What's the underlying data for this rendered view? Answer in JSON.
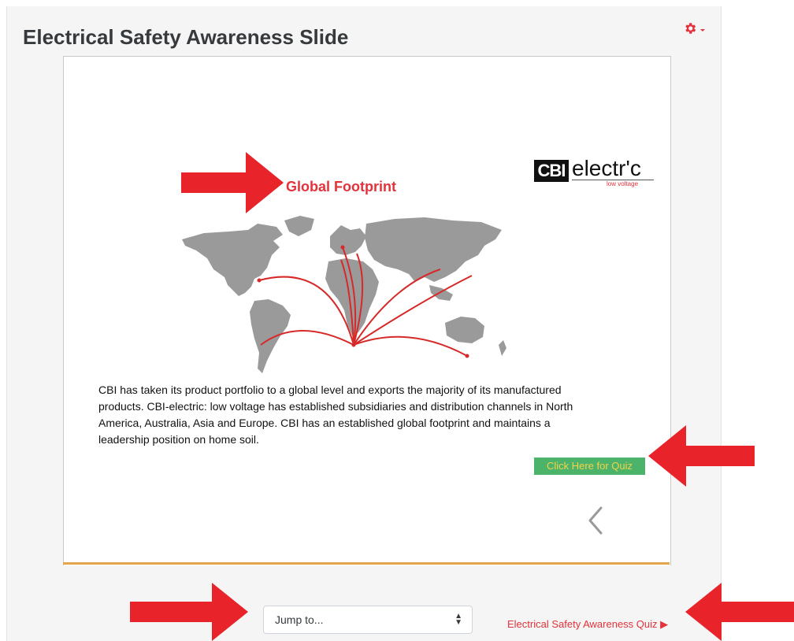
{
  "page": {
    "title": "Electrical Safety Awareness Slide"
  },
  "settings": {
    "icon": "gear-icon",
    "caret_icon": "caret-down-icon"
  },
  "slide": {
    "heading": "Global Footprint",
    "logo": {
      "mark": "CBI",
      "word": "electr'c",
      "tagline": "low voltage"
    },
    "description": "CBI has taken its product portfolio to a global level and exports the majority of its manufactured products. CBI-electric: low voltage has established subsidiaries and distribution channels in North America, Australia, Asia and Europe. CBI has an established global footprint and maintains a leadership position on home soil.",
    "quiz_button": "Click Here for Quiz",
    "prev_icon": "chevron-left-icon"
  },
  "navigation": {
    "jump_select": "Jump to...",
    "next_activity": "Electrical Safety Awareness Quiz ▶"
  },
  "colors": {
    "accent_red": "#e3323b",
    "quiz_green": "#4cb36a",
    "quiz_text": "#f1d34a",
    "slide_bar": "#e5a54c",
    "annotation_arrow": "#e8232a"
  }
}
